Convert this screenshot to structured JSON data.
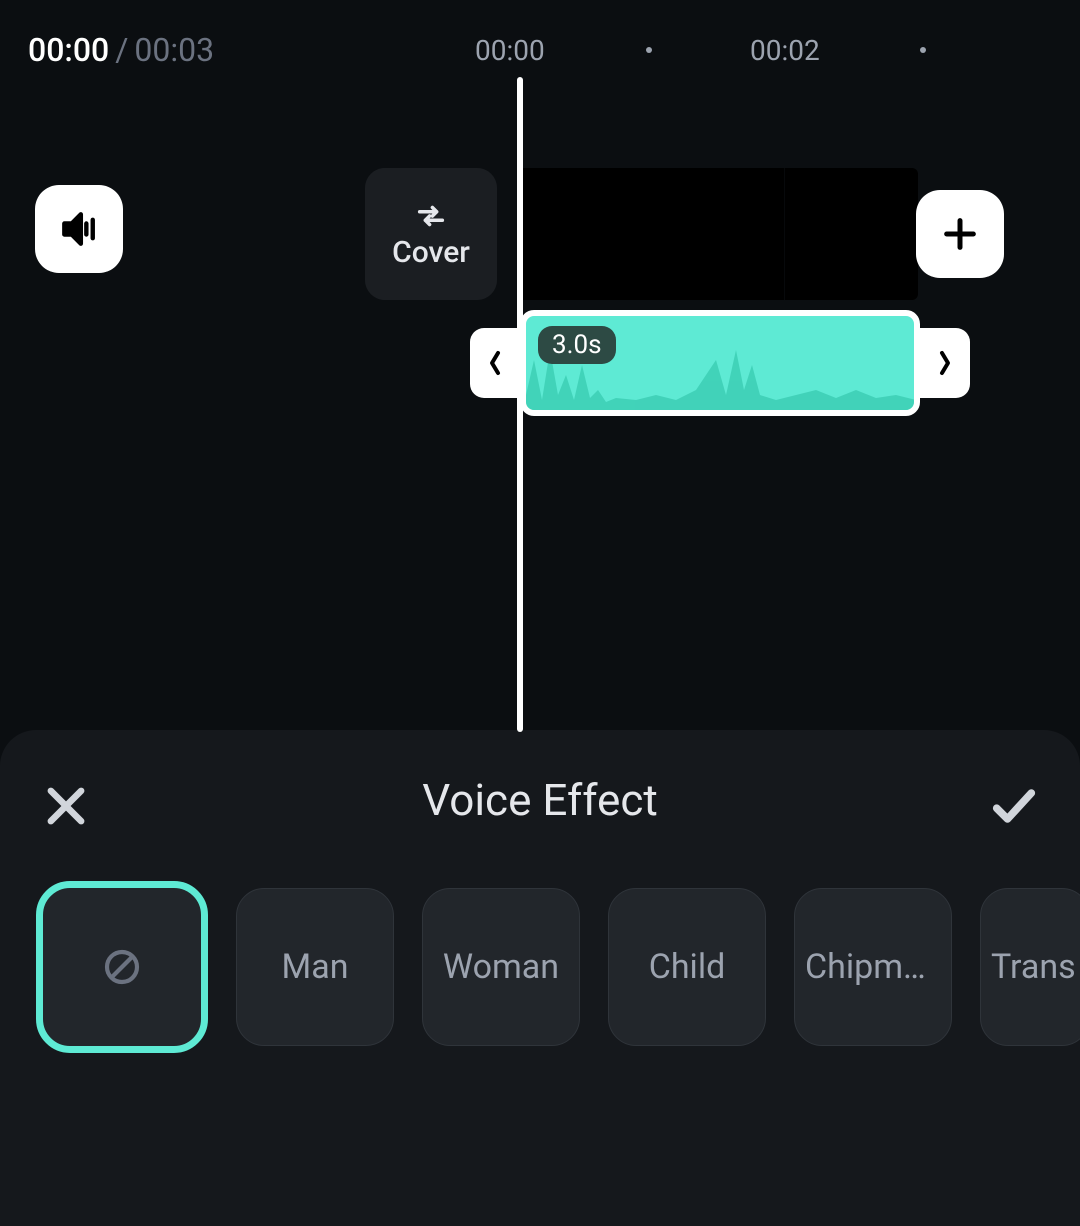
{
  "time": {
    "current": "00:00",
    "separator": " / ",
    "total": "00:03",
    "ruler": [
      "00:00",
      "00:02"
    ]
  },
  "cover": {
    "label": "Cover"
  },
  "audio_clip": {
    "duration": "3.0s"
  },
  "panel": {
    "title": "Voice Effect"
  },
  "effects": [
    {
      "id": "none",
      "label": "",
      "selected": true
    },
    {
      "id": "man",
      "label": "Man",
      "selected": false
    },
    {
      "id": "woman",
      "label": "Woman",
      "selected": false
    },
    {
      "id": "child",
      "label": "Child",
      "selected": false
    },
    {
      "id": "chipmunk",
      "label": "Chipmu…",
      "selected": false
    },
    {
      "id": "transformer",
      "label": "Trans",
      "selected": false
    }
  ]
}
